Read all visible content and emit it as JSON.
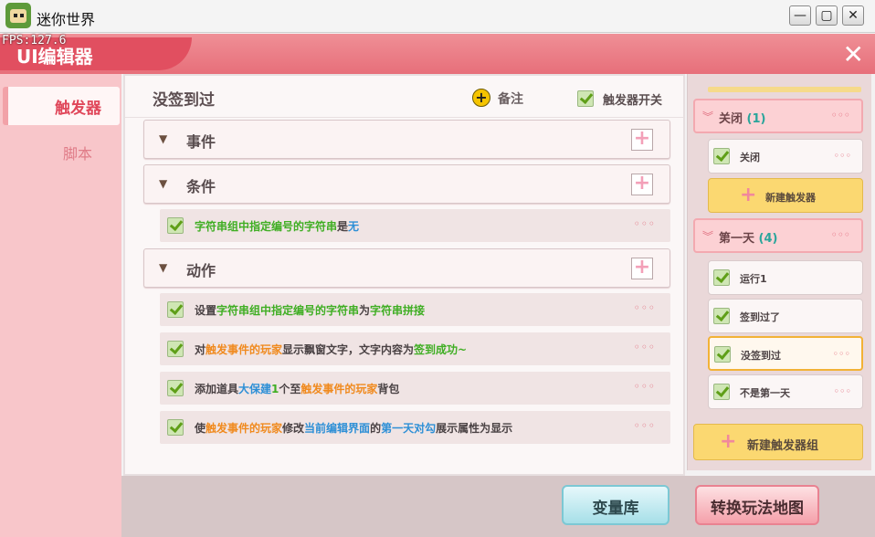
{
  "window": {
    "title": "迷你世界",
    "minimize": "—",
    "maximize": "▢",
    "close": "✕"
  },
  "editor": {
    "fps": "FPS:127.6",
    "title": "UI编辑器",
    "close": "✕"
  },
  "tabs": {
    "trigger": "触发器",
    "script": "脚本"
  },
  "main": {
    "title": "没签到过",
    "note_label": "备注",
    "toggle_label": "触发器开关",
    "sections": {
      "event": "事件",
      "condition": "条件",
      "action": "动作"
    },
    "condition_rows": [
      {
        "parts": [
          "字符串组中指定编号的字符串",
          "是",
          "无"
        ]
      }
    ],
    "action_rows": [
      {
        "parts": [
          "设置",
          "字符串组中指定编号的字符串",
          "为",
          "字符串拼接"
        ]
      },
      {
        "parts": [
          "对",
          "触发事件的玩家",
          "显示飘窗文字，文字内容为",
          "签到成功~"
        ]
      },
      {
        "parts": [
          "添加道具",
          "大保建",
          "1",
          "个至",
          "触发事件的玩家",
          "背包"
        ]
      },
      {
        "parts": [
          "使",
          "触发事件的玩家",
          "修改",
          "当前编辑界面",
          "的",
          "第一天对勾",
          "展示属性为显示"
        ]
      }
    ],
    "more": "◦◦◦"
  },
  "right": {
    "groups": [
      {
        "name": "关闭",
        "count": "(1)"
      },
      {
        "name": "第一天",
        "count": "(4)"
      }
    ],
    "group1_items": [
      "关闭"
    ],
    "new_trigger": "新建触发器",
    "group2_items": [
      "运行1",
      "签到过了",
      "没签到过",
      "不是第一天"
    ],
    "new_group": "新建触发器组",
    "more": "◦◦◦"
  },
  "footer": {
    "variables": "变量库",
    "switch_map": "转换玩法地图"
  },
  "colors": {
    "header": "#e76f7a",
    "accent_green": "#3fae23",
    "accent_blue": "#2d8fd6",
    "accent_orange": "#f08a1e"
  }
}
